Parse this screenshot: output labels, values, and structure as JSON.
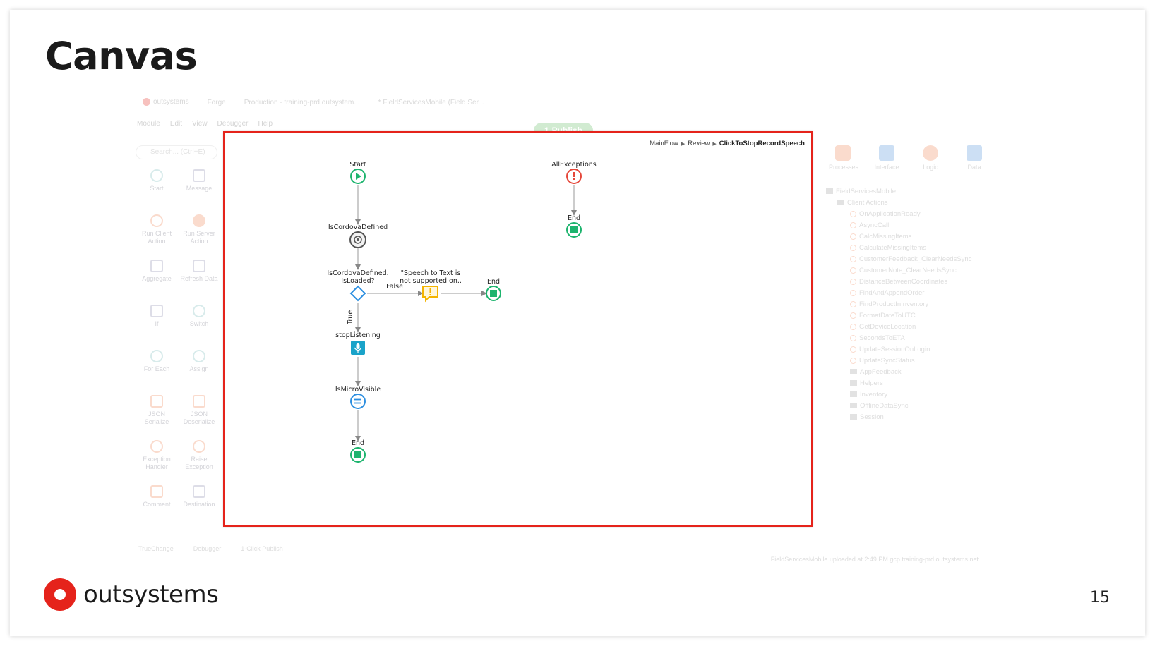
{
  "slide": {
    "title": "Canvas",
    "page_number": "15",
    "logo_text": "outsystems"
  },
  "ide": {
    "brand": "outsystems",
    "tabs": [
      "Forge",
      "Production - training-prd.outsystem...",
      "* FieldServicesMobile (Field Ser..."
    ],
    "menu": [
      "Module",
      "Edit",
      "View",
      "Debugger",
      "Help"
    ],
    "publish_label": "Publish",
    "publish_count": "1",
    "search_placeholder": "Search... (Ctrl+E)",
    "toolbox": [
      {
        "label": "Start",
        "icon": "start-icon"
      },
      {
        "label": "Message",
        "icon": "message-icon"
      },
      {
        "label": "Run Client Action",
        "icon": "run-client-action-icon"
      },
      {
        "label": "Run Server Action",
        "icon": "run-server-action-icon"
      },
      {
        "label": "Aggregate",
        "icon": "aggregate-icon"
      },
      {
        "label": "Refresh Data",
        "icon": "refresh-data-icon"
      },
      {
        "label": "If",
        "icon": "if-icon"
      },
      {
        "label": "Switch",
        "icon": "switch-icon"
      },
      {
        "label": "For Each",
        "icon": "for-each-icon"
      },
      {
        "label": "Assign",
        "icon": "assign-icon"
      },
      {
        "label": "JSON Serialize",
        "icon": "json-serialize-icon"
      },
      {
        "label": "JSON Deserialize",
        "icon": "json-deserialize-icon"
      },
      {
        "label": "Exception Handler",
        "icon": "exception-handler-icon"
      },
      {
        "label": "Raise Exception",
        "icon": "raise-exception-icon"
      },
      {
        "label": "Comment",
        "icon": "comment-icon"
      },
      {
        "label": "Destination",
        "icon": "destination-icon"
      }
    ],
    "right_tabs": [
      "Processes",
      "Interface",
      "Logic",
      "Data"
    ],
    "tree": {
      "root": "FieldServicesMobile",
      "group": "Client Actions",
      "actions": [
        "OnApplicationReady",
        "AsyncCall",
        "CalcMissingItems",
        "CalculateMissingItems",
        "CustomerFeedback_ClearNeedsSync",
        "CustomerNote_ClearNeedsSync",
        "DistanceBetweenCoordinates",
        "FindAndAppendOrder",
        "FindProductInInventory",
        "FormatDateToUTC",
        "GetDeviceLocation",
        "SecondsToETA",
        "UpdateSessionOnLogin",
        "UpdateSyncStatus"
      ],
      "folders": [
        "AppFeedback",
        "Helpers",
        "Inventory",
        "OfflineDataSync",
        "Session"
      ]
    },
    "bottom_tabs": [
      "TrueChange",
      "Debugger",
      "1-Click Publish"
    ],
    "status_text": "FieldServicesMobile uploaded at 2:49 PM",
    "status_env": "gcp",
    "status_server": "training-prd.outsystems.net"
  },
  "canvas": {
    "breadcrumb": [
      "MainFlow",
      "Review",
      "ClickToStopRecordSpeech"
    ],
    "nodes": {
      "start": "Start",
      "is_cordova_defined": "IsCordovaDefined",
      "if_line1": "IsCordovaDefined.",
      "if_line2": "IsLoaded?",
      "message_line1": "\"Speech to Text is",
      "message_line2": "not supported on..",
      "end_right": "End",
      "stop_listening": "stopListening",
      "is_micro_visible": "IsMicroVisible",
      "end_bottom": "End",
      "all_exceptions": "AllExceptions",
      "end_exception": "End"
    },
    "branches": {
      "false_label": "False",
      "true_label": "True"
    },
    "colors": {
      "start_end": "#1db46e",
      "exception": "#e5473a",
      "if_diamond": "#2d8fe0",
      "message": "#f4b400",
      "action": "#1aa3c9",
      "highlight_border": "#e5231b"
    }
  }
}
